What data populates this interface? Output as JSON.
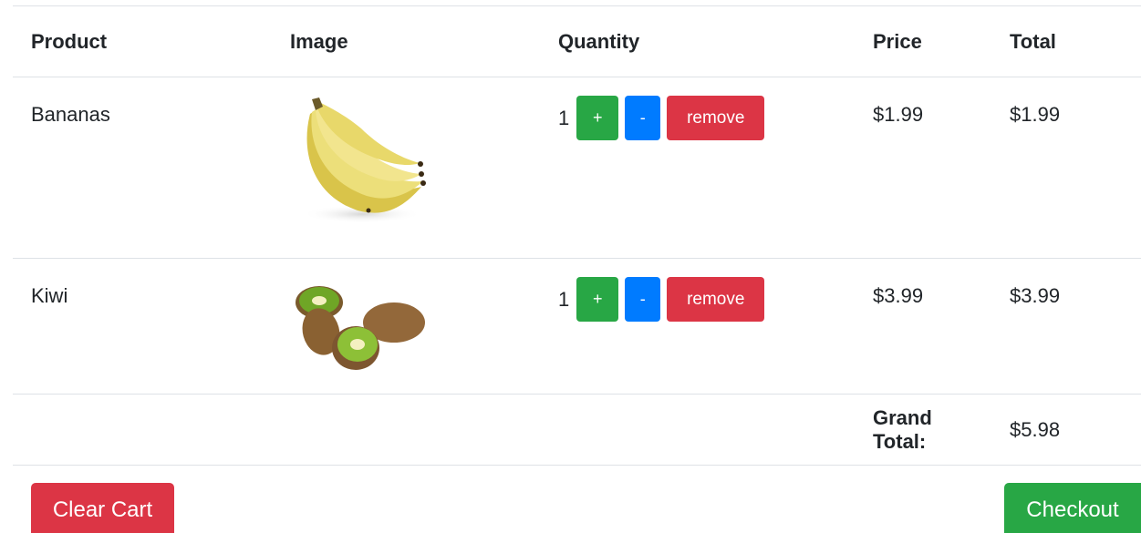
{
  "table": {
    "headers": {
      "product": "Product",
      "image": "Image",
      "quantity": "Quantity",
      "price": "Price",
      "total": "Total"
    },
    "rows": [
      {
        "product": "Bananas",
        "image_icon": "bananas-image",
        "quantity": "1",
        "plus_label": "+",
        "minus_label": "-",
        "remove_label": "remove",
        "price": "$1.99",
        "total": "$1.99"
      },
      {
        "product": "Kiwi",
        "image_icon": "kiwi-image",
        "quantity": "1",
        "plus_label": "+",
        "minus_label": "-",
        "remove_label": "remove",
        "price": "$3.99",
        "total": "$3.99"
      }
    ],
    "grand_total_label": "Grand Total:",
    "grand_total_value": "$5.98"
  },
  "actions": {
    "clear_label": "Clear Cart",
    "checkout_label": "Checkout"
  },
  "colors": {
    "success": "#28a745",
    "primary": "#007bff",
    "danger": "#dc3545",
    "border": "#dee2e6"
  }
}
